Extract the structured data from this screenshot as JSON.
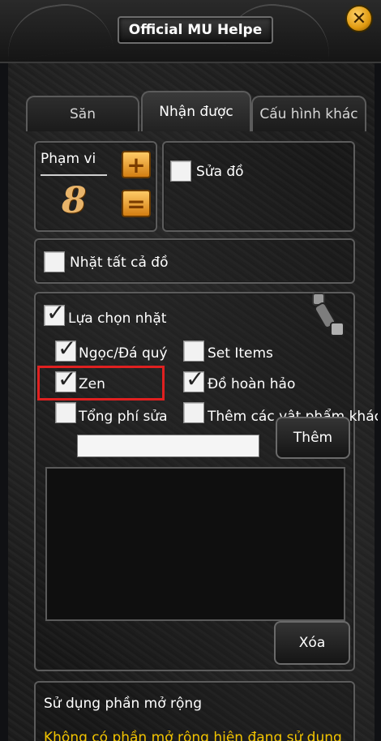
{
  "window": {
    "title": "Official MU Helpe"
  },
  "tabs": [
    {
      "label": "Săn"
    },
    {
      "label": "Nhận được"
    },
    {
      "label": "Cấu hình khác"
    }
  ],
  "range": {
    "label": "Phạm vi",
    "value": "8"
  },
  "repair": {
    "label": "Sửa đồ",
    "checked": false
  },
  "pickup_all": {
    "label": "Nhặt tất cả đồ",
    "checked": false
  },
  "pickup_selection": {
    "label": "Lựa chọn nhặt",
    "checked": true,
    "options": [
      {
        "label": "Ngọc/Đá quý",
        "checked": true
      },
      {
        "label": "Set Items",
        "checked": false
      },
      {
        "label": "Zen",
        "checked": true
      },
      {
        "label": "Đồ hoàn hảo",
        "checked": true
      },
      {
        "label": "Tổng phí sửa",
        "checked": false
      },
      {
        "label": "Thêm các vật phẩm khác",
        "checked": false
      }
    ]
  },
  "add_button": {
    "label": "Thêm"
  },
  "delete_button": {
    "label": "Xóa"
  },
  "extension": {
    "label": "Sử dụng phần mở rộng",
    "warning": "Không có phần mở rộng hiện đang sử dụng"
  },
  "colors": {
    "highlight": "#e02020",
    "warning": "#f2c400",
    "gold": "#e8a436"
  }
}
